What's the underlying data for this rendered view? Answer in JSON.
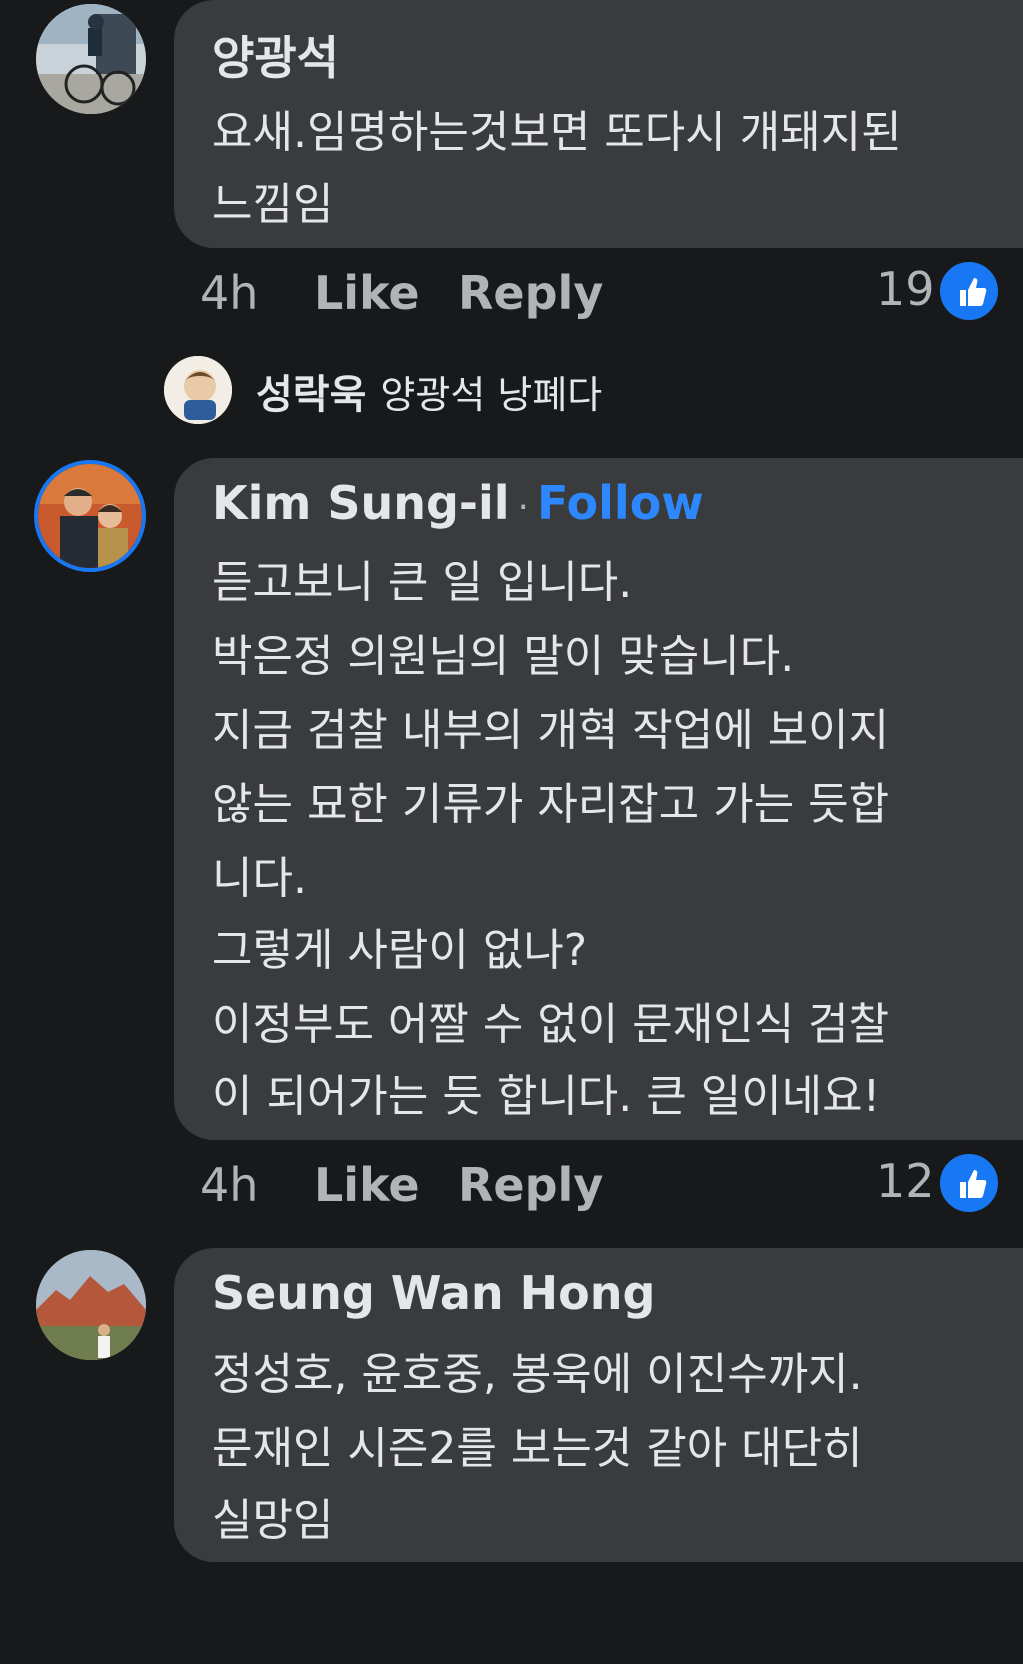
{
  "comments": [
    {
      "author": "양광석",
      "lines": [
        "요새.임명하는것보면 또다시 개돼지된",
        "느낌임"
      ],
      "time": "4h",
      "like_label": "Like",
      "reply_label": "Reply",
      "reaction_count": "19"
    },
    {
      "author": "Kim Sung-il",
      "separator": "·",
      "follow_label": "Follow",
      "lines": [
        "듣고보니 큰 일 입니다.",
        "박은정 의원님의 말이 맞습니다.",
        "지금 검찰 내부의 개혁 작업에 보이지",
        "않는 묘한 기류가 자리잡고 가는 듯합",
        "니다.",
        "그렇게 사람이 없나?",
        "이정부도 어짤 수 없이 문재인식 검찰",
        "이 되어가는 듯 합니다. 큰 일이네요!"
      ],
      "time": "4h",
      "like_label": "Like",
      "reply_label": "Reply",
      "reaction_count": "12"
    },
    {
      "author": "Seung Wan Hong",
      "lines": [
        "정성호, 윤호중, 봉욱에 이진수까지.",
        "문재인 시즌2를 보는것 같아 대단히",
        "실망임"
      ]
    }
  ],
  "reply_preview": {
    "author": "성락욱",
    "text": "양광석 낭폐다"
  },
  "colors": {
    "background": "#18191a",
    "bubble": "#3a3b3c",
    "text": "#e4e6eb",
    "muted": "#b0b3b8",
    "accent": "#2d88ff",
    "like_blue": "#1877f2"
  }
}
